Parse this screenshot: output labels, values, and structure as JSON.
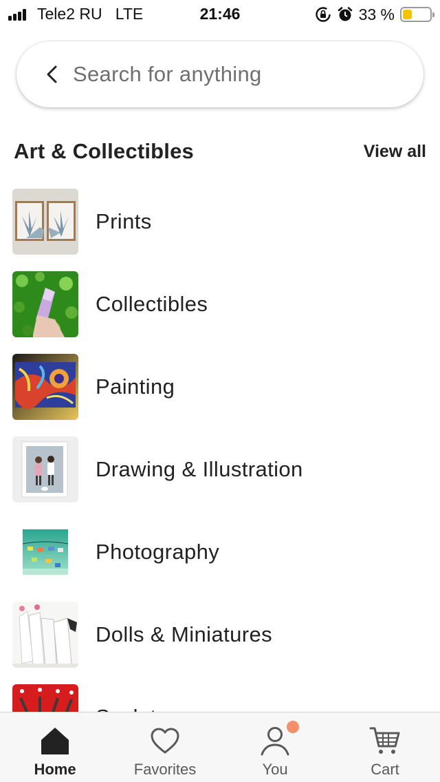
{
  "status_bar": {
    "carrier": "Tele2 RU",
    "network": "LTE",
    "time": "21:46",
    "battery_percent_text": "33 %",
    "battery_level": 0.33,
    "battery_color": "#f5c400",
    "icons": [
      "signal-bars-icon",
      "rotation-lock-icon",
      "alarm-icon",
      "battery-icon"
    ]
  },
  "search": {
    "placeholder": "Search for anything",
    "value": "",
    "back_icon": "chevron-left-icon"
  },
  "section": {
    "title": "Art & Collectibles",
    "view_all": "View all"
  },
  "categories": [
    {
      "label": "Prints"
    },
    {
      "label": "Collectibles"
    },
    {
      "label": "Painting"
    },
    {
      "label": "Drawing & Illustration"
    },
    {
      "label": "Photography"
    },
    {
      "label": "Dolls & Miniatures"
    },
    {
      "label": "Sculpture"
    }
  ],
  "bottom_nav": {
    "tabs": [
      {
        "label": "Home",
        "icon": "home-icon",
        "active": true
      },
      {
        "label": "Favorites",
        "icon": "heart-icon",
        "active": false
      },
      {
        "label": "You",
        "icon": "person-icon",
        "active": false,
        "notification": true
      },
      {
        "label": "Cart",
        "icon": "cart-icon",
        "active": false
      }
    ],
    "notification_color": "#f1906b"
  }
}
